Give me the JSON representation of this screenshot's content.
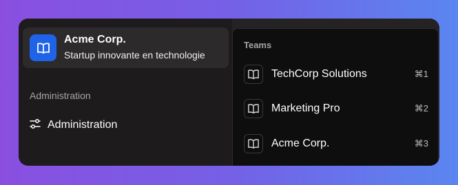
{
  "org": {
    "name": "Acme Corp.",
    "subtitle": "Startup innovante en technologie",
    "logo_icon": "book-icon",
    "logo_color": "#1f63e8"
  },
  "sidebar": {
    "section_label": "Administration",
    "items": [
      {
        "label": "Administration",
        "icon": "sliders-icon"
      }
    ]
  },
  "dropdown": {
    "heading": "Teams",
    "teams": [
      {
        "name": "TechCorp Solutions",
        "shortcut": "⌘1",
        "icon": "book-icon"
      },
      {
        "name": "Marketing Pro",
        "shortcut": "⌘2",
        "icon": "book-icon"
      },
      {
        "name": "Acme Corp.",
        "shortcut": "⌘3",
        "icon": "book-icon"
      }
    ]
  }
}
